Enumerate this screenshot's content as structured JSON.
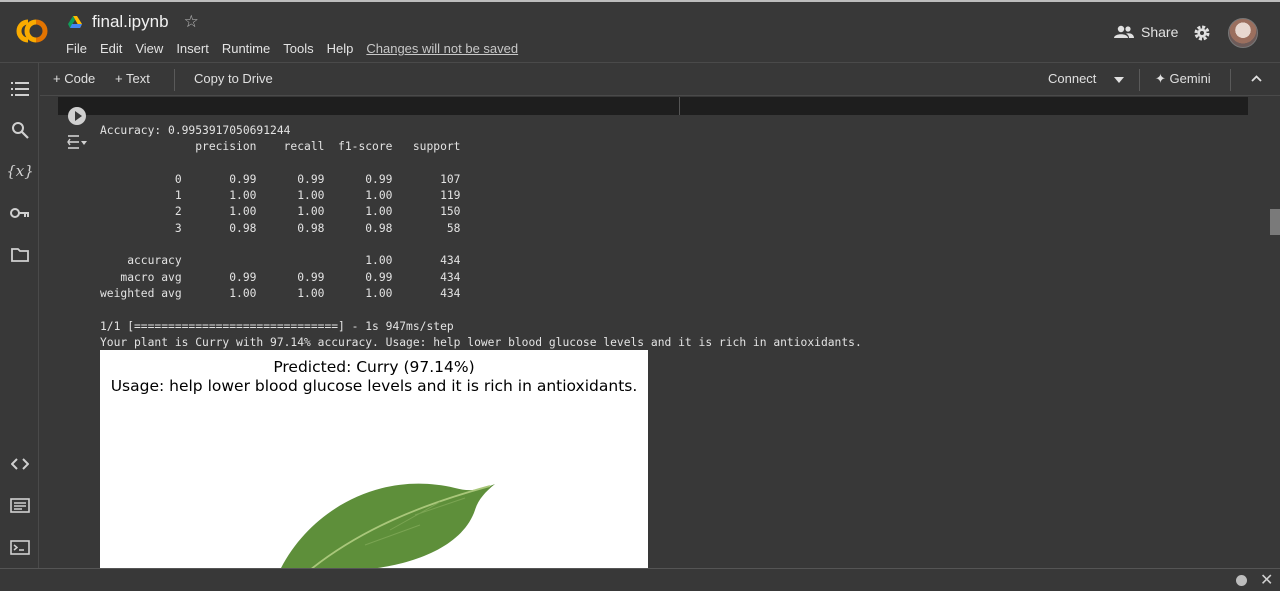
{
  "app": {
    "logo_text": "CO"
  },
  "notebook": {
    "title": "final.ipynb"
  },
  "menu": {
    "items": [
      "File",
      "Edit",
      "View",
      "Insert",
      "Runtime",
      "Tools",
      "Help"
    ],
    "unsaved": "Changes will not be saved"
  },
  "header": {
    "share_label": "Share"
  },
  "toolbar": {
    "code_label": "+ Code",
    "text_label": "+ Text",
    "copy_label": "Copy to Drive",
    "connect_label": "Connect",
    "gemini_label": "✦ Gemini"
  },
  "output": {
    "text": "Accuracy: 0.9953917050691244\n              precision    recall  f1-score   support\n\n           0       0.99      0.99      0.99       107\n           1       1.00      1.00      1.00       119\n           2       1.00      1.00      1.00       150\n           3       0.98      0.98      0.98        58\n\n    accuracy                           1.00       434\n   macro avg       0.99      0.99      0.99       434\nweighted avg       1.00      1.00      1.00       434\n\n1/1 [==============================] - 1s 947ms/step\nYour plant is Curry with 97.14% accuracy. Usage: help lower blood glucose levels and it is rich in antioxidants."
  },
  "figure": {
    "title_line1": "Predicted: Curry (97.14%)",
    "title_line2": "Usage: help lower blood glucose levels and it is rich in antioxidants."
  },
  "icons": {
    "sidebar": [
      "toc-icon",
      "search-icon",
      "variables-icon",
      "key-icon",
      "folder-icon",
      "code-snippets-icon",
      "command-palette-icon",
      "terminal-icon"
    ]
  },
  "colors": {
    "bg": "#383838",
    "accent_orange": "#f9ab00",
    "leaf_green": "#5e8f3a"
  }
}
